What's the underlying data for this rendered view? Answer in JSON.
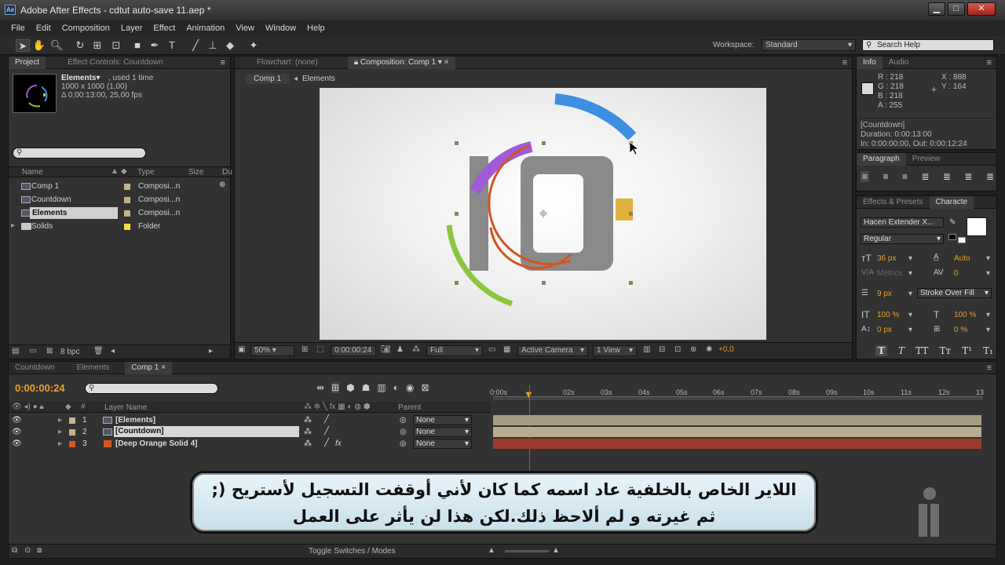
{
  "window": {
    "title": "Adobe After Effects - cdtut auto-save 11.aep *",
    "app_icon": "Ae",
    "minimize": "▁",
    "maximize": "□",
    "close": "✕"
  },
  "menubar": [
    "File",
    "Edit",
    "Composition",
    "Layer",
    "Effect",
    "Animation",
    "View",
    "Window",
    "Help"
  ],
  "toolbar": {
    "workspace_label": "Workspace:",
    "workspace_value": "Standard",
    "search_placeholder": "Search Help"
  },
  "project": {
    "tabs": [
      "Project",
      "Effect Controls: Countdown"
    ],
    "selected_name": "Elements▾",
    "selected_used": ", used 1 time",
    "selected_size": "1000 x 1000 (1,00)",
    "selected_duration": "Δ 0;00:13:00, 25,00 fps",
    "columns": [
      "Name",
      "Type",
      "Size",
      "Du"
    ],
    "items": [
      {
        "name": "Comp 1",
        "type": "Composi...n",
        "icon": "comp",
        "label_color": "#c9b08a"
      },
      {
        "name": "Countdown",
        "type": "Composi...n",
        "icon": "comp",
        "label_color": "#c9b08a"
      },
      {
        "name": "Elements",
        "type": "Composi...n",
        "icon": "comp",
        "label_color": "#c9b08a"
      },
      {
        "name": "Solids",
        "type": "Folder",
        "icon": "folder",
        "label_color": "#f0e040"
      }
    ],
    "bpc": "8 bpc"
  },
  "composition": {
    "tabs": [
      "Flowchart: (none)",
      "Composition: Comp 1"
    ],
    "breadcrumbs": [
      "Comp 1",
      "Elements"
    ],
    "zoom": "50%",
    "timecode": "0:00:00:24",
    "resolution": "Full",
    "camera": "Active Camera",
    "views": "1 View",
    "exposure": "+0,0"
  },
  "info": {
    "tabs": [
      "Info",
      "Audio"
    ],
    "r": "R : 218",
    "g": "G : 218",
    "b": "B : 218",
    "a": "A : 255",
    "x": "X : 888",
    "y": "Y : 164",
    "layer_name": "[Countdown]",
    "duration": "Duration: 0:00:13:00",
    "in_out": "In: 0:00:00:00, Out: 0:00:12:24"
  },
  "paragraph": {
    "tabs": [
      "Paragraph",
      "Preview"
    ]
  },
  "character": {
    "tabs": [
      "Effects & Presets",
      "Characte"
    ],
    "font": "Hacen Extender X...",
    "style": "Regular",
    "size": "36 px",
    "leading": "Auto",
    "kerning": "Metrics",
    "tracking": "0",
    "stroke_width": "9 px",
    "stroke_mode": "Stroke Over Fill",
    "vscale": "100 %",
    "hscale": "100 %",
    "baseline": "0 px",
    "tsume": "0 %"
  },
  "timeline": {
    "tabs": [
      "Countdown",
      "Elements",
      "Comp 1"
    ],
    "timecode": "0:00:00:24",
    "columns": [
      "Layer Name",
      "Parent"
    ],
    "ruler": [
      "0:00s",
      "02s",
      "03s",
      "04s",
      "05s",
      "06s",
      "07s",
      "08s",
      "09s",
      "10s",
      "11s",
      "12s",
      "13"
    ],
    "layers": [
      {
        "num": "1",
        "name": "[Elements]",
        "parent": "None",
        "color": "#c9b08a",
        "fx": ""
      },
      {
        "num": "2",
        "name": "[Countdown]",
        "parent": "None",
        "color": "#c9b08a",
        "fx": ""
      },
      {
        "num": "3",
        "name": "[Deep Orange Solid 4]",
        "parent": "None",
        "color": "#d45a1e",
        "fx": "fx"
      }
    ],
    "toggle_label": "Toggle Switches / Modes"
  },
  "subtitle": {
    "line1": "اللاير الخاص بالخلفية عاد اسمه كما كان لأني أوقفت التسجيل لأستريح (;",
    "line2": "ثم غيرته و لم ألاحظ ذلك.لكن هذا لن يأثر على العمل"
  },
  "colors": {
    "timecode": "#e8a42a",
    "playhead": "#e33333",
    "bar_tan": "#a89b80",
    "bar_red": "#9e3a2c",
    "arc_blue": "#3d8fe0",
    "arc_purple": "#a25ad8",
    "arc_green": "#8cc63e",
    "arc_orange": "#d0561e",
    "square_yellow": "#e0b13c",
    "glyph_gray": "#8a8a8a"
  }
}
